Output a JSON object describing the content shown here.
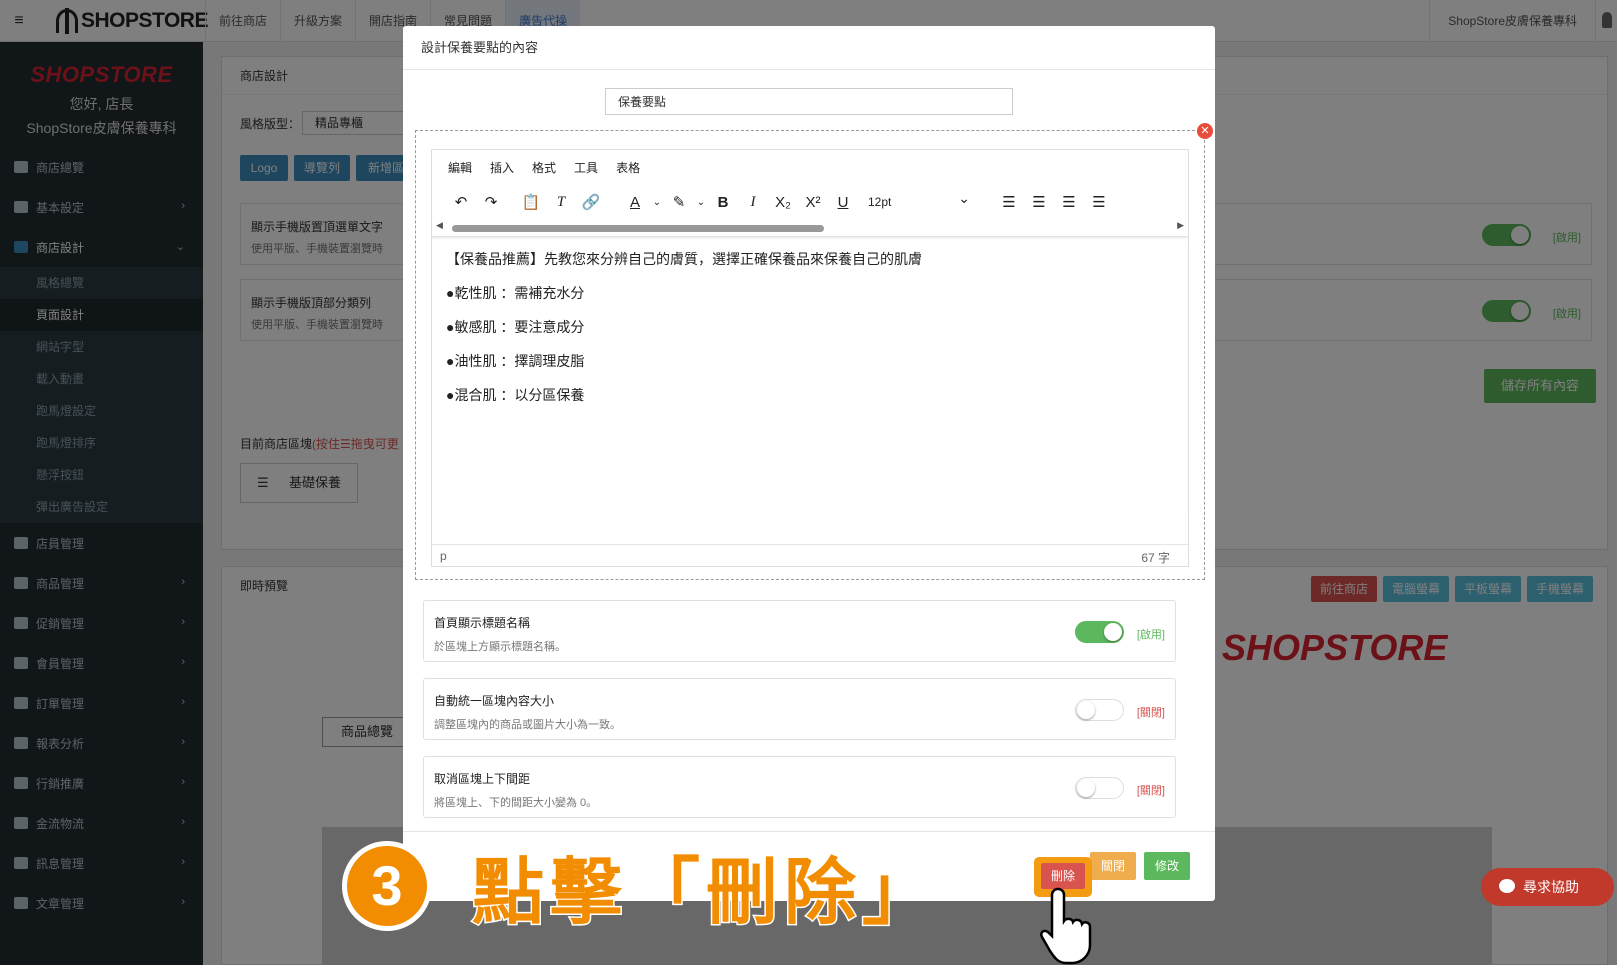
{
  "topbar": {
    "logo": "SHOPSTORE",
    "nav": [
      "前往商店",
      "升級方案",
      "開店指南",
      "常見問題",
      "廣告代操"
    ],
    "shop_name": "ShopStore皮膚保養專科"
  },
  "sidebar": {
    "logo": "SHOPSTORE",
    "greeting": "您好, 店長",
    "shop": "ShopStore皮膚保養專科",
    "items": [
      {
        "label": "商店總覽",
        "icon": "dashboard-icon"
      },
      {
        "label": "基本設定",
        "icon": "bank-icon"
      },
      {
        "label": "商店設計",
        "icon": "brush-icon"
      }
    ],
    "sub_items": [
      "風格總覽",
      "頁面設計",
      "網站字型",
      "載入動畫",
      "跑馬燈設定",
      "跑馬燈排序",
      "懸浮按鈕",
      "彈出廣告設定"
    ],
    "items2": [
      {
        "label": "店員管理",
        "icon": "lock-icon"
      },
      {
        "label": "商品管理",
        "icon": "cart-icon"
      },
      {
        "label": "促銷管理",
        "icon": "gift-icon"
      },
      {
        "label": "會員管理",
        "icon": "users-icon"
      },
      {
        "label": "訂單管理",
        "icon": "copy-icon"
      },
      {
        "label": "報表分析",
        "icon": "chart-icon"
      },
      {
        "label": "行銷推廣",
        "icon": "bullhorn-icon"
      },
      {
        "label": "金流物流",
        "icon": "dollar-icon"
      },
      {
        "label": "訊息管理",
        "icon": "comments-icon"
      },
      {
        "label": "文章管理",
        "icon": "edit-icon"
      }
    ]
  },
  "main": {
    "header": "商店設計",
    "style_label": "風格版型：",
    "style_value": "精品專櫃",
    "tabs": [
      "Logo",
      "導覽列",
      "新增區"
    ],
    "setting1_title": "顯示手機版置頂選單文字",
    "setting1_desc": "使用平版、手機裝置瀏覽時",
    "setting2_title": "顯示手機版頂部分類列",
    "setting2_desc": "使用平版、手機裝置瀏覽時",
    "enabled": "[啟用]",
    "save": "儲存所有內容",
    "blocks_label": "目前商店區塊",
    "blocks_hint": "(按住☰拖曳可更",
    "block1": "基礎保養"
  },
  "preview": {
    "header": "即時預覽",
    "buttons": [
      "前往商店",
      "電腦螢幕",
      "平板螢幕",
      "手機螢幕"
    ],
    "brand": "SHOPSTORE",
    "product_tab": "商品總覽"
  },
  "modal": {
    "title": "設計保養要點的內容",
    "input_value": "保養要點",
    "editor_menu": [
      "編輯",
      "插入",
      "格式",
      "工具",
      "表格"
    ],
    "font_size": "12pt",
    "content": [
      "【保養品推薦】先教您來分辨自己的膚質，選擇正確保養品來保養自己的肌膚",
      "●乾性肌 ：需補充水分",
      "●敏感肌 ：要注意成分",
      "●油性肌 ：擇調理皮脂",
      "●混合肌 ：以分區保養"
    ],
    "status_path": "p",
    "word_count": "67 字",
    "settings": [
      {
        "title": "首頁顯示標題名稱",
        "desc": "於區塊上方顯示標題名稱。",
        "on": true,
        "state": "[啟用]"
      },
      {
        "title": "自動統一區塊內容大小",
        "desc": "調整區塊內的商品或圖片大小為一致。",
        "on": false,
        "state": "[關閉]"
      },
      {
        "title": "取消區塊上下間距",
        "desc": "將區塊上、下的間距大小變為 0。",
        "on": false,
        "state": "[關閉]"
      }
    ],
    "delete": "刪除",
    "close": "關閉",
    "modify": "修改"
  },
  "callout": {
    "number": "3",
    "text": "點擊「刪除」"
  },
  "help": "尋求協助",
  "colors": {
    "accent": "#f28c00",
    "brand_red": "#d9232f"
  }
}
